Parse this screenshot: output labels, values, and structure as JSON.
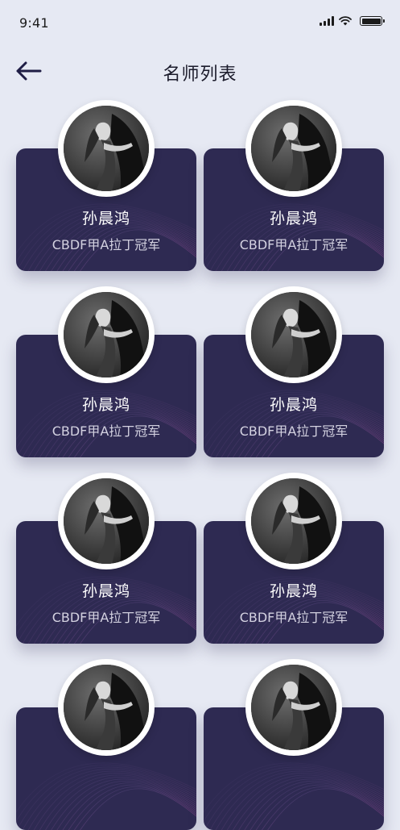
{
  "status_bar": {
    "time": "9:41"
  },
  "nav": {
    "title": "名师列表",
    "back_icon": "arrow-left-icon"
  },
  "colors": {
    "background": "#e6e9f3",
    "card": "#2e2a52",
    "wave_accent": "#9b3f86"
  },
  "teachers": [
    {
      "name": "孙晨鸿",
      "title": "CBDF甲A拉丁冠军"
    },
    {
      "name": "孙晨鸿",
      "title": "CBDF甲A拉丁冠军"
    },
    {
      "name": "孙晨鸿",
      "title": "CBDF甲A拉丁冠军"
    },
    {
      "name": "孙晨鸿",
      "title": "CBDF甲A拉丁冠军"
    },
    {
      "name": "孙晨鸿",
      "title": "CBDF甲A拉丁冠军"
    },
    {
      "name": "孙晨鸿",
      "title": "CBDF甲A拉丁冠军"
    },
    {
      "name": "",
      "title": ""
    },
    {
      "name": "",
      "title": ""
    }
  ]
}
